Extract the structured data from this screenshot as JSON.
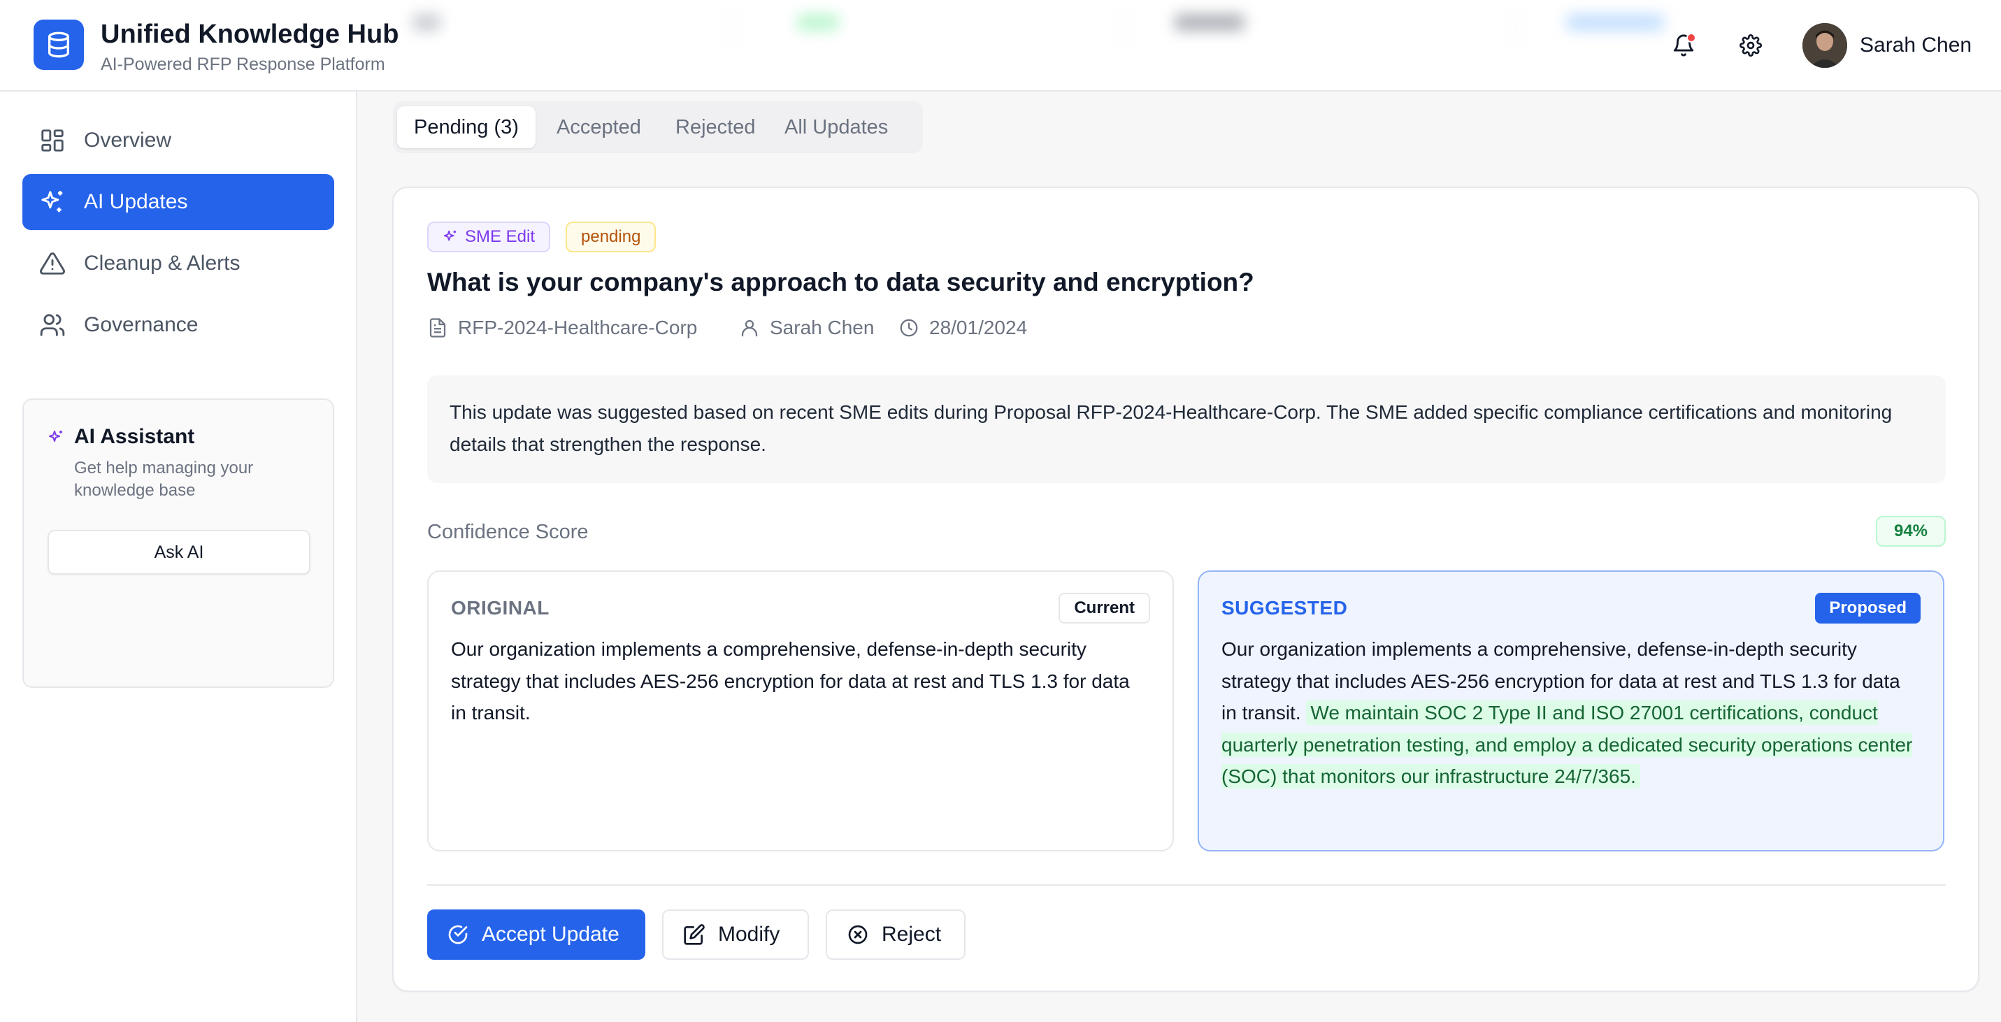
{
  "app": {
    "title": "Unified Knowledge Hub",
    "subtitle": "AI-Powered RFP Response Platform"
  },
  "header": {
    "user_name": "Sarah Chen",
    "notification_icon": "bell-icon",
    "settings_icon": "gear-icon"
  },
  "sidebar": {
    "items": [
      {
        "label": "Overview",
        "icon": "grid-icon"
      },
      {
        "label": "AI Updates",
        "icon": "sparkles-icon",
        "active": true
      },
      {
        "label": "Cleanup & Alerts",
        "icon": "warning-icon"
      },
      {
        "label": "Governance",
        "icon": "users-icon"
      }
    ],
    "assistant": {
      "title": "AI Assistant",
      "description": "Get help managing your knowledge base",
      "button": "Ask AI"
    }
  },
  "tabs": [
    {
      "label": "Pending (3)",
      "active": true
    },
    {
      "label": "Accepted"
    },
    {
      "label": "Rejected"
    },
    {
      "label": "All Updates"
    }
  ],
  "update": {
    "badges": {
      "source": "SME Edit",
      "status": "pending"
    },
    "question": "What is your company's approach to data security and encryption?",
    "meta": {
      "proposal": "RFP-2024-Healthcare-Corp",
      "author": "Sarah Chen",
      "date": "28/01/2024"
    },
    "reason": "This update was suggested based on recent SME edits during Proposal RFP-2024-Healthcare-Corp. The SME added specific compliance certifications and monitoring details that strengthen the response.",
    "confidence_label": "Confidence Score",
    "confidence_value": "94%",
    "original": {
      "title": "ORIGINAL",
      "pill": "Current",
      "text": "Our organization implements a comprehensive, defense-in-depth security strategy that includes AES-256 encryption for data at rest and TLS 1.3 for data in transit."
    },
    "suggested": {
      "title": "SUGGESTED",
      "pill": "Proposed",
      "text": "Our organization implements a comprehensive, defense-in-depth security strategy that includes AES-256 encryption for data at rest and TLS 1.3 for data in transit.",
      "added_text": "We maintain SOC 2 Type II and ISO 27001 certifications, conduct quarterly penetration testing, and employ a dedicated security operations center (SOC) that monitors our infrastructure 24/7/365."
    },
    "actions": {
      "accept": "Accept Update",
      "modify": "Modify",
      "reject": "Reject"
    }
  },
  "colors": {
    "primary": "#2563eb",
    "sme_purple": "#7c3aed",
    "pending_amber": "#b45309",
    "success_green": "#15803d",
    "added_highlight": "#dcfce7"
  }
}
